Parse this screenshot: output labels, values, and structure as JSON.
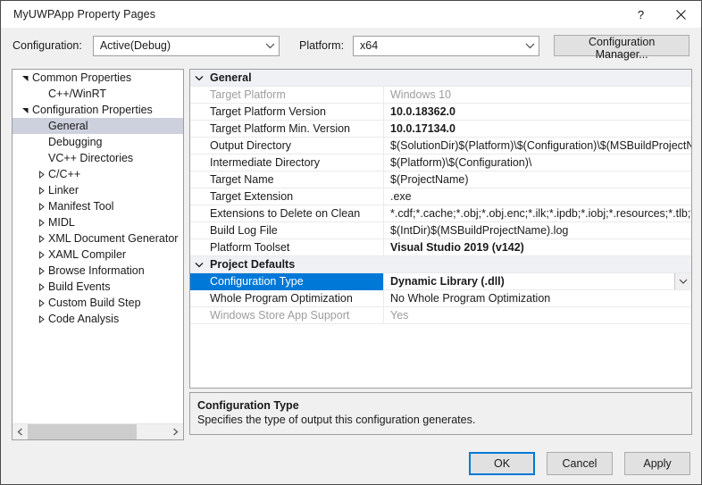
{
  "window": {
    "title": "MyUWPApp Property Pages",
    "help_icon": "question-mark-icon",
    "close_icon": "close-icon"
  },
  "toolbar": {
    "configuration_label": "Configuration:",
    "configuration_value": "Active(Debug)",
    "platform_label": "Platform:",
    "platform_value": "x64",
    "configuration_manager_label": "Configuration Manager..."
  },
  "tree": {
    "items": [
      {
        "label": "Common Properties",
        "indent": 0,
        "state": "expanded",
        "selected": false
      },
      {
        "label": "C++/WinRT",
        "indent": 1,
        "state": "leaf",
        "selected": false
      },
      {
        "label": "Configuration Properties",
        "indent": 0,
        "state": "expanded",
        "selected": false
      },
      {
        "label": "General",
        "indent": 1,
        "state": "leaf",
        "selected": true
      },
      {
        "label": "Debugging",
        "indent": 1,
        "state": "leaf",
        "selected": false
      },
      {
        "label": "VC++ Directories",
        "indent": 1,
        "state": "leaf",
        "selected": false
      },
      {
        "label": "C/C++",
        "indent": 1,
        "state": "collapsed",
        "selected": false
      },
      {
        "label": "Linker",
        "indent": 1,
        "state": "collapsed",
        "selected": false
      },
      {
        "label": "Manifest Tool",
        "indent": 1,
        "state": "collapsed",
        "selected": false
      },
      {
        "label": "MIDL",
        "indent": 1,
        "state": "collapsed",
        "selected": false
      },
      {
        "label": "XML Document Generator",
        "indent": 1,
        "state": "collapsed",
        "selected": false
      },
      {
        "label": "XAML Compiler",
        "indent": 1,
        "state": "collapsed",
        "selected": false
      },
      {
        "label": "Browse Information",
        "indent": 1,
        "state": "collapsed",
        "selected": false
      },
      {
        "label": "Build Events",
        "indent": 1,
        "state": "collapsed",
        "selected": false
      },
      {
        "label": "Custom Build Step",
        "indent": 1,
        "state": "collapsed",
        "selected": false
      },
      {
        "label": "Code Analysis",
        "indent": 1,
        "state": "collapsed",
        "selected": false
      }
    ]
  },
  "grid": {
    "categories": [
      {
        "name": "General",
        "expanded": true,
        "rows": [
          {
            "name": "Target Platform",
            "value": "Windows 10",
            "disabled": true,
            "bold": false,
            "selected": false,
            "dropdown": false
          },
          {
            "name": "Target Platform Version",
            "value": "10.0.18362.0",
            "disabled": false,
            "bold": true,
            "selected": false,
            "dropdown": false
          },
          {
            "name": "Target Platform Min. Version",
            "value": "10.0.17134.0",
            "disabled": false,
            "bold": true,
            "selected": false,
            "dropdown": false
          },
          {
            "name": "Output Directory",
            "value": "$(SolutionDir)$(Platform)\\$(Configuration)\\$(MSBuildProjectName)\\",
            "disabled": false,
            "bold": false,
            "selected": false,
            "dropdown": false
          },
          {
            "name": "Intermediate Directory",
            "value": "$(Platform)\\$(Configuration)\\",
            "disabled": false,
            "bold": false,
            "selected": false,
            "dropdown": false
          },
          {
            "name": "Target Name",
            "value": "$(ProjectName)",
            "disabled": false,
            "bold": false,
            "selected": false,
            "dropdown": false
          },
          {
            "name": "Target Extension",
            "value": ".exe",
            "disabled": false,
            "bold": false,
            "selected": false,
            "dropdown": false
          },
          {
            "name": "Extensions to Delete on Clean",
            "value": "*.cdf;*.cache;*.obj;*.obj.enc;*.ilk;*.ipdb;*.iobj;*.resources;*.tlb;*.tli;*.tlh",
            "disabled": false,
            "bold": false,
            "selected": false,
            "dropdown": false
          },
          {
            "name": "Build Log File",
            "value": "$(IntDir)$(MSBuildProjectName).log",
            "disabled": false,
            "bold": false,
            "selected": false,
            "dropdown": false
          },
          {
            "name": "Platform Toolset",
            "value": "Visual Studio 2019 (v142)",
            "disabled": false,
            "bold": true,
            "selected": false,
            "dropdown": false
          }
        ]
      },
      {
        "name": "Project Defaults",
        "expanded": true,
        "rows": [
          {
            "name": "Configuration Type",
            "value": "Dynamic Library (.dll)",
            "disabled": false,
            "bold": true,
            "selected": true,
            "dropdown": true
          },
          {
            "name": "Whole Program Optimization",
            "value": "No Whole Program Optimization",
            "disabled": false,
            "bold": false,
            "selected": false,
            "dropdown": false
          },
          {
            "name": "Windows Store App Support",
            "value": "Yes",
            "disabled": true,
            "bold": false,
            "selected": false,
            "dropdown": false
          }
        ]
      }
    ]
  },
  "description": {
    "title": "Configuration Type",
    "text": "Specifies the type of output this configuration generates."
  },
  "footer": {
    "ok_label": "OK",
    "cancel_label": "Cancel",
    "apply_label": "Apply"
  },
  "colors": {
    "accent": "#0078D7",
    "tree_selection": "#CDD0DD",
    "category_bg": "#EFF1F5",
    "dialog_bg": "#F0F0F0"
  }
}
